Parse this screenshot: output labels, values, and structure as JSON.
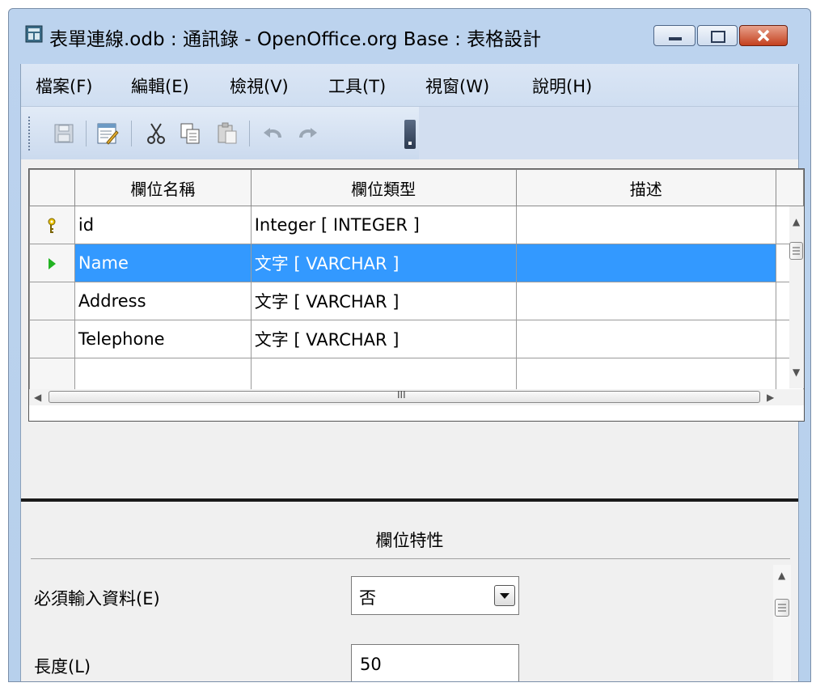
{
  "window": {
    "title": "表單連線.odb : 通訊錄 - OpenOffice.org Base : 表格設計",
    "minimize_label": "minimize",
    "maximize_label": "maximize",
    "close_label": "close"
  },
  "menu": [
    "檔案(F)",
    "編輯(E)",
    "檢視(V)",
    "工具(T)",
    "視窗(W)",
    "說明(H)"
  ],
  "toolbar": {
    "icons": [
      "save-icon",
      "edit-icon",
      "cut-icon",
      "copy-icon",
      "paste-icon",
      "undo-icon",
      "redo-icon"
    ]
  },
  "grid": {
    "headers": [
      "欄位名稱",
      "欄位類型",
      "描述"
    ],
    "rows": [
      {
        "indicator": "primary-key",
        "name": "id",
        "type": "Integer [ INTEGER ]",
        "desc": ""
      },
      {
        "indicator": "current",
        "name": "Name",
        "type": "文字 [ VARCHAR ]",
        "desc": ""
      },
      {
        "indicator": "",
        "name": "Address",
        "type": "文字 [ VARCHAR ]",
        "desc": ""
      },
      {
        "indicator": "",
        "name": "Telephone",
        "type": "文字 [ VARCHAR ]",
        "desc": ""
      },
      {
        "indicator": "",
        "name": "",
        "type": "",
        "desc": ""
      },
      {
        "indicator": "",
        "name": "",
        "type": "",
        "desc": ""
      }
    ],
    "scroll_thumb_label": "III"
  },
  "properties": {
    "title": "欄位特性",
    "required_label": "必須輸入資料(E)",
    "required_value": "否",
    "length_label": "長度(L)",
    "length_value": "50"
  },
  "colors": {
    "selection": "#3399ff",
    "titlebar": "#bcd3ee",
    "menubar": "#d4e1f2"
  }
}
